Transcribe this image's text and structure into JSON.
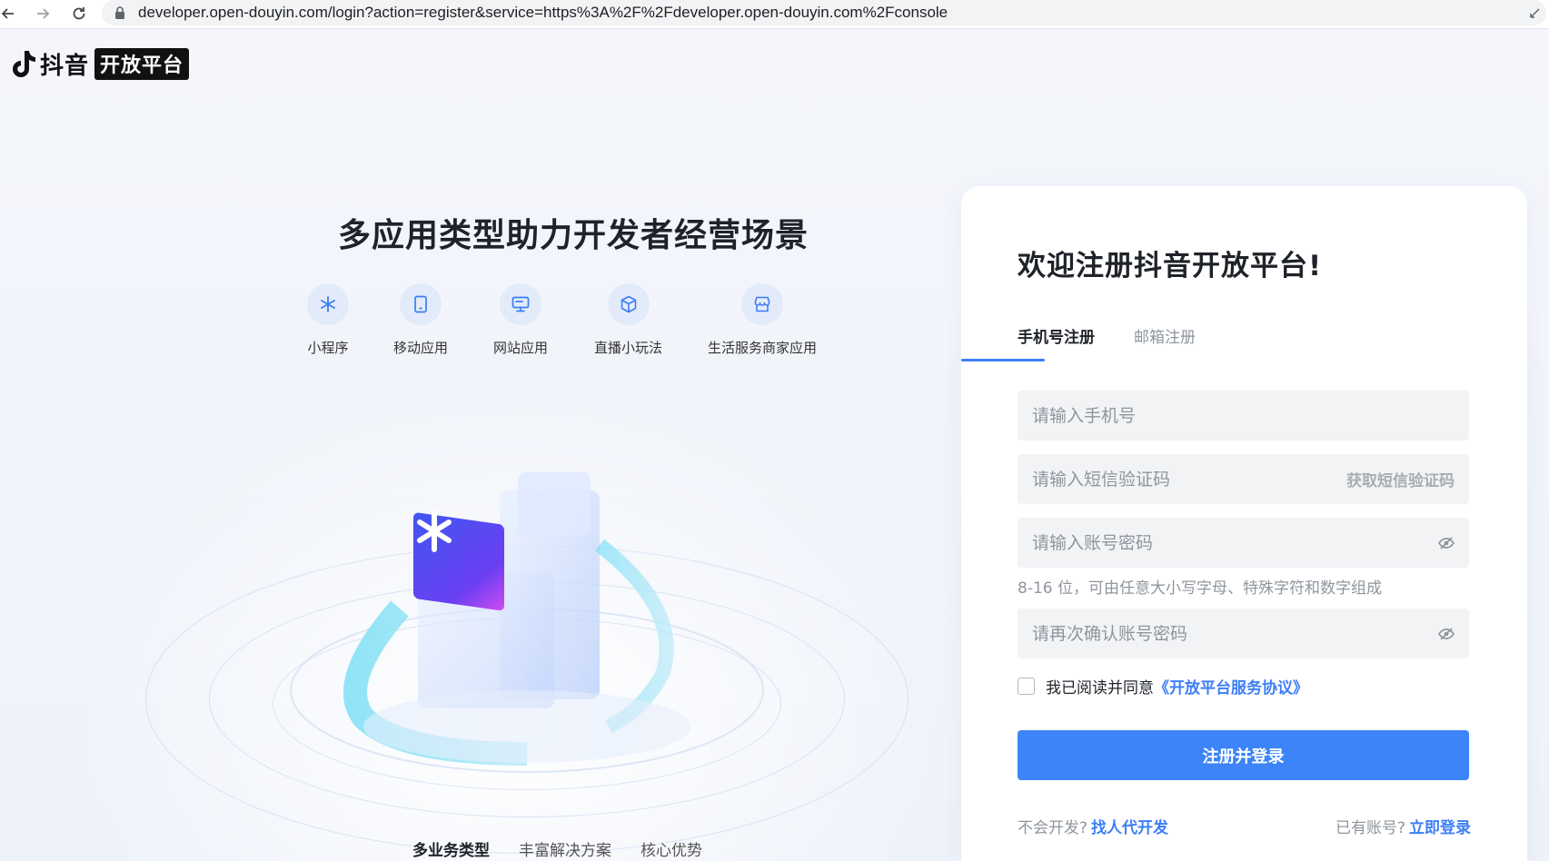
{
  "browser": {
    "url": "developer.open-douyin.com/login?action=register&service=https%3A%2F%2Fdeveloper.open-douyin.com%2Fconsole"
  },
  "logo": {
    "word": "抖音",
    "badge": "开放平台"
  },
  "hero": {
    "title": "多应用类型助力开发者经营场景",
    "app_types": [
      {
        "label": "小程序",
        "icon": "asterisk-icon"
      },
      {
        "label": "移动应用",
        "icon": "phone-icon"
      },
      {
        "label": "网站应用",
        "icon": "monitor-icon"
      },
      {
        "label": "直播小玩法",
        "icon": "cube-icon"
      },
      {
        "label": "生活服务商家应用",
        "icon": "store-icon"
      }
    ],
    "tabs": [
      {
        "label": "多业务类型",
        "active": true
      },
      {
        "label": "丰富解决方案",
        "active": false
      },
      {
        "label": "核心优势",
        "active": false
      }
    ]
  },
  "register": {
    "title": "欢迎注册抖音开放平台!",
    "tabs": {
      "phone": "手机号注册",
      "email": "邮箱注册"
    },
    "phone_placeholder": "请输入手机号",
    "sms_placeholder": "请输入短信验证码",
    "sms_button": "获取短信验证码",
    "password_placeholder": "请输入账号密码",
    "password_hint": "8-16 位，可由任意大小写字母、特殊字符和数字组成",
    "confirm_placeholder": "请再次确认账号密码",
    "agree_text": "我已阅读并同意",
    "agree_link": "《开放平台服务协议》",
    "submit_label": "注册并登录",
    "footer": {
      "left_text": "不会开发?",
      "left_link": "找人代开发",
      "right_text": "已有账号?",
      "right_link": "立即登录"
    }
  },
  "colors": {
    "accent": "#3c84f7",
    "link": "#3c7ef6",
    "field_bg": "#f2f3f5",
    "page_bg": "#f3f5fb"
  }
}
